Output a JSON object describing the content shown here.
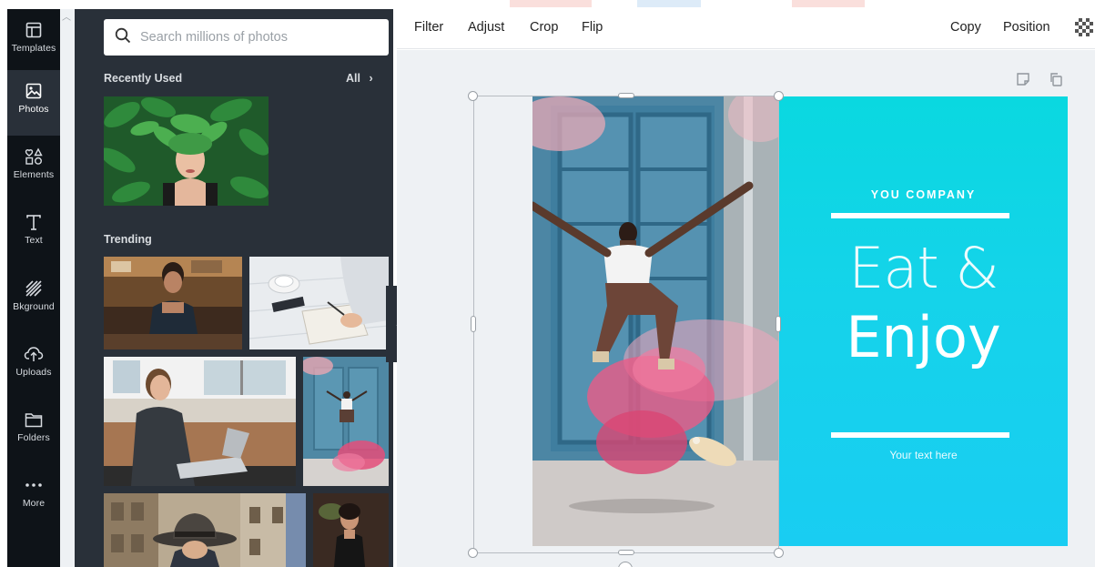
{
  "sidebar": {
    "items": [
      {
        "label": "Templates",
        "icon": "templates-icon"
      },
      {
        "label": "Photos",
        "icon": "photos-icon",
        "active": true
      },
      {
        "label": "Elements",
        "icon": "elements-icon"
      },
      {
        "label": "Text",
        "icon": "text-icon"
      },
      {
        "label": "Bkground",
        "icon": "background-icon"
      },
      {
        "label": "Uploads",
        "icon": "uploads-icon"
      },
      {
        "label": "Folders",
        "icon": "folders-icon"
      },
      {
        "label": "More",
        "icon": "more-icon"
      }
    ]
  },
  "panel": {
    "search_placeholder": "Search millions of photos",
    "recently_used_title": "Recently Used",
    "all_label": "All",
    "trending_title": "Trending"
  },
  "toolbar": {
    "filter": "Filter",
    "adjust": "Adjust",
    "crop": "Crop",
    "flip": "Flip",
    "copy": "Copy",
    "position": "Position"
  },
  "design": {
    "company": "YOU COMPANY",
    "line1": "Eat &",
    "line2": "Enjoy",
    "tagline": "Your text here"
  },
  "colors": {
    "rail_bg": "#0e1318",
    "panel_bg": "#293039",
    "teal": "#15d3ea",
    "canvas_bg": "#eef1f4"
  }
}
